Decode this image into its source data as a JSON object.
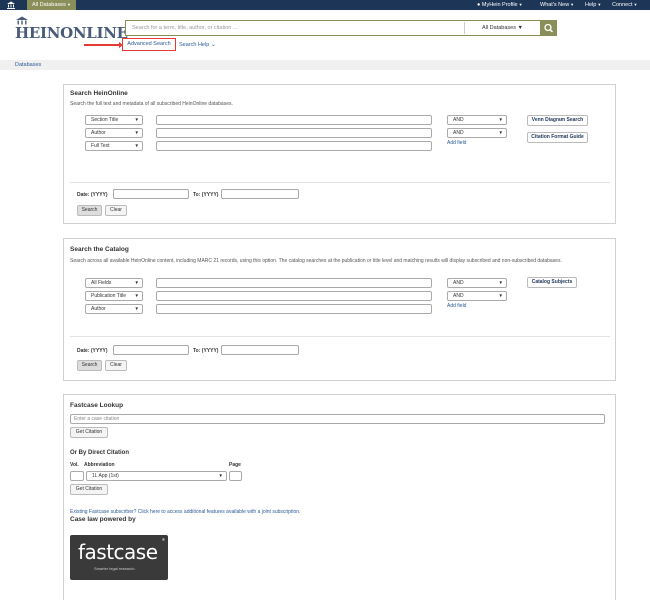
{
  "topbar": {
    "databases_label": "All Databases",
    "profile_label": "MyHein Profile",
    "whats_new_label": "What's New",
    "help_label": "Help",
    "connect_label": "Connect"
  },
  "header": {
    "logo_text": "HEINONLINE",
    "search_placeholder": "Search for a term, title, author, or citation ...",
    "search_scope": "All Databases",
    "advanced_search": "Advanced Search",
    "search_help": "Search Help"
  },
  "breadcrumb": {
    "label": "Databases"
  },
  "search_heinonline": {
    "title": "Search HeinOnline",
    "description": "Search the full text and metadata of all subscribed HeinOnline databases.",
    "fields": [
      "Section Title",
      "Author",
      "Full Text"
    ],
    "operators": [
      "AND",
      "AND"
    ],
    "add_field": "Add field",
    "venn_button": "Venn Diagram Search",
    "citation_button": "Citation Format Guide",
    "date_from_label": "Date: (YYYY)",
    "date_to_label": "To: (YYYY)",
    "search_button": "Search",
    "clear_button": "Clear"
  },
  "search_catalog": {
    "title": "Search the Catalog",
    "description": "Search across all available HeinOnline content, including MARC 21 records, using this option. The catalog searches at the publication or title level and matching results will display subscribed and non-subscribed databases.",
    "fields": [
      "All Fields",
      "Publication Title",
      "Author"
    ],
    "operators": [
      "AND",
      "AND"
    ],
    "add_field": "Add field",
    "subjects_button": "Catalog Subjects",
    "date_from_label": "Date: (YYYY)",
    "date_to_label": "To: (YYYY)",
    "search_button": "Search",
    "clear_button": "Clear"
  },
  "fastcase": {
    "title": "Fastcase Lookup",
    "citation_placeholder": "Enter a case citation",
    "get_citation": "Get Citation",
    "direct_title": "Or By Direct Citation",
    "vol_label": "Vol.",
    "abbrev_label": "Abbreviation",
    "page_label": "Page",
    "abbrev_value": "1L App (1st)",
    "get_citation_2": "Get Citation",
    "subscriber_link": "Existing Fastcase subscriber? Click here to access additional features available with a joint subscription.",
    "powered_by": "Case law powered by",
    "logo_word": "fastcase",
    "logo_tagline": "Smarter legal research."
  },
  "colors": {
    "navy": "#1d3557",
    "olive": "#8a8f5a",
    "link": "#2b5b9a",
    "highlight": "#e53935"
  }
}
